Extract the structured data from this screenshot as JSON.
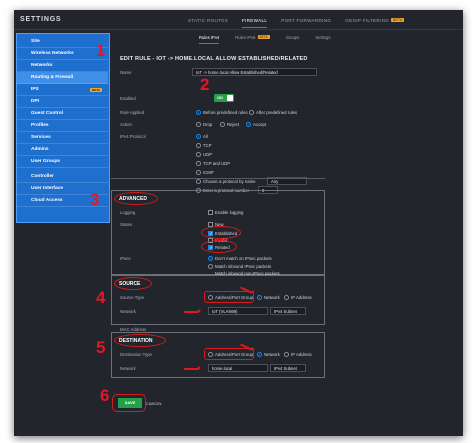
{
  "app": {
    "title": "SETTINGS"
  },
  "top_tabs": [
    {
      "label": "STATIC ROUTES",
      "active": false
    },
    {
      "label": "FIREWALL",
      "active": true
    },
    {
      "label": "PORT FORWARDING",
      "active": false
    },
    {
      "label": "GEOIP FILTERING",
      "active": false,
      "badge": "BETA"
    }
  ],
  "sidebar": {
    "items": [
      {
        "label": "Site"
      },
      {
        "label": "Wireless Networks"
      },
      {
        "label": "Networks"
      },
      {
        "label": "Routing & Firewall",
        "active": true
      },
      {
        "label": "IPS",
        "badge": "BETA"
      },
      {
        "label": "DPI"
      },
      {
        "label": "Guest Control"
      },
      {
        "label": "Profiles"
      },
      {
        "label": "Services"
      },
      {
        "label": "Admins"
      },
      {
        "label": "User Groups"
      },
      {
        "label": "Controller"
      },
      {
        "label": "User Interface"
      },
      {
        "label": "Cloud Access"
      }
    ]
  },
  "sub_tabs": [
    {
      "label": "Rules IPv4",
      "active": true
    },
    {
      "label": "Rules IPv6",
      "badge": "BETA"
    },
    {
      "label": "Groups"
    },
    {
      "label": "Settings"
    }
  ],
  "edit_title": "EDIT RULE - IOT -> HOME.LOCAL ALLOW ESTABLISHED/RELATED",
  "fields": {
    "name_label": "Name",
    "name_value": "IoT -> home.local Allow Established/Related",
    "enabled_label": "Enabled",
    "enabled_value": "ON",
    "rule_applied_label": "Rule Applied",
    "rule_applied_options": [
      "Before predefined rules",
      "After predefined rules"
    ],
    "action_label": "Action",
    "action_options": [
      "Drop",
      "Reject",
      "Accept"
    ],
    "protocol_label": "IPv4 Protocol",
    "protocol_options": [
      "All",
      "TCP",
      "UDP",
      "TCP and UDP",
      "ICMP",
      "Choose a protocol by name",
      "Enter a protocol number"
    ],
    "protocol_name_value": "Any",
    "protocol_number_value": "0"
  },
  "advanced": {
    "title": "ADVANCED",
    "logging_label": "Logging",
    "logging_option": "Enable logging",
    "states_label": "States",
    "states": [
      "New",
      "Established",
      "Invalid",
      "Related"
    ],
    "ipsec_label": "IPsec",
    "ipsec_options": [
      "Don't match on IPsec packets",
      "Match inbound IPsec packets",
      "Match inbound non-IPsec packets"
    ]
  },
  "source": {
    "title": "SOURCE",
    "type_label": "Source Type",
    "type_options": [
      "Address/Port Group",
      "Network",
      "IP Address"
    ],
    "network_label": "Network",
    "network_value": "IoT (VLAN69)",
    "network_subnet": "IPv4 Subnet",
    "mac_label": "MAC Address"
  },
  "destination": {
    "title": "DESTINATION",
    "type_label": "Destination Type",
    "type_options": [
      "Address/Port Group",
      "Network",
      "IP Address"
    ],
    "network_label": "Network",
    "network_value": "home.local",
    "network_subnet": "IPv4 Subnet"
  },
  "actions": {
    "save": "SAVE",
    "cancel": "CANCEL"
  },
  "steps": [
    "1",
    "2",
    "3",
    "4",
    "5",
    "6"
  ],
  "colors": {
    "accent": "#1e88e5",
    "sidebar": "#1f6fcf",
    "save": "#24a148",
    "annotation": "#d81b1b"
  }
}
